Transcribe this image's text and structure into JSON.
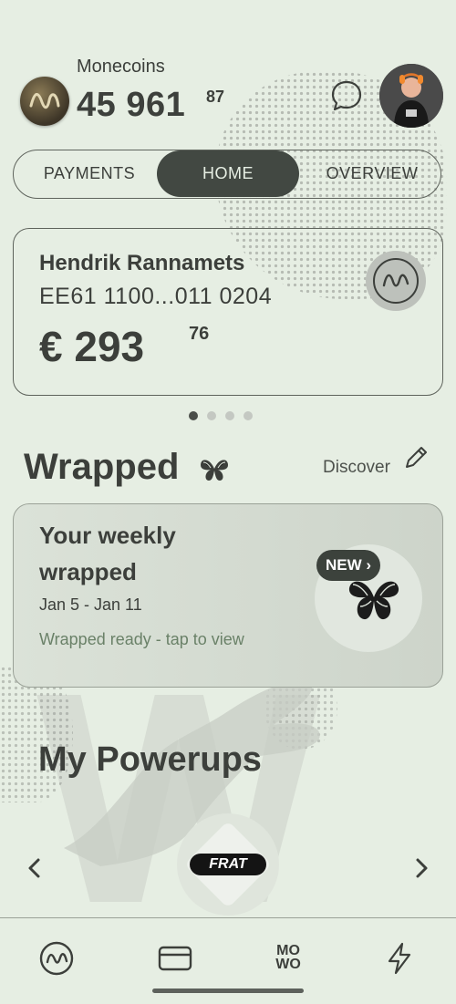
{
  "header": {
    "coins_label": "Monecoins",
    "coins_integer": "45 961",
    "coins_decimal": "87",
    "icons": [
      "coin-icon",
      "chat-icon",
      "avatar"
    ]
  },
  "tabs": [
    {
      "label": "PAYMENTS",
      "active": false
    },
    {
      "label": "HOME",
      "active": true
    },
    {
      "label": "OVERVIEW",
      "active": false
    }
  ],
  "account_card": {
    "holder": "Hendrik Rannamets",
    "iban": "EE61 1100...011 0204",
    "balance_integer": "€ 293",
    "balance_decimal": "76",
    "pager_count": 4,
    "pager_active": 1
  },
  "wrapped": {
    "title": "Wrapped",
    "discover": "Discover",
    "card_title": "Your weekly wrapped",
    "date_range": "Jan 5 - Jan 11",
    "status": "Wrapped ready - tap to view",
    "badge": "NEW"
  },
  "powerups": {
    "title": "My Powerups",
    "items": [
      {
        "label": "FRAT"
      }
    ]
  },
  "bottom_nav": {
    "items": [
      "home-icon",
      "card-icon",
      "mowo-icon",
      "bolt-icon"
    ],
    "mowo_text": "MO WO"
  },
  "colors": {
    "background": "#e6eee3",
    "text": "#3c3f3b",
    "accent_dark": "#424842",
    "status_green": "#6a8168"
  }
}
